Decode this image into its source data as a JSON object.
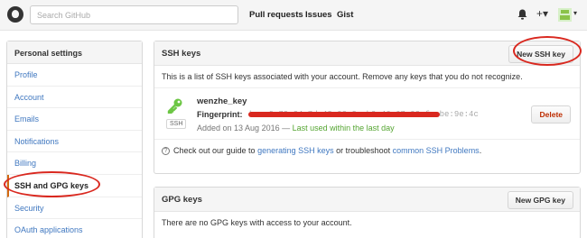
{
  "header": {
    "search_placeholder": "Search GitHub",
    "nav": [
      "Pull requests",
      "Issues",
      "Gist"
    ],
    "plus_glyph": "+▾",
    "bell_glyph": "🔔"
  },
  "sidebar": {
    "title": "Personal settings",
    "items": [
      {
        "label": "Profile"
      },
      {
        "label": "Account"
      },
      {
        "label": "Emails"
      },
      {
        "label": "Notifications"
      },
      {
        "label": "Billing"
      },
      {
        "label": "SSH and GPG keys"
      },
      {
        "label": "Security"
      },
      {
        "label": "OAuth applications"
      }
    ]
  },
  "ssh": {
    "title": "SSH keys",
    "new_button": "New SSH key",
    "description": "This is a list of SSH keys associated with your account. Remove any keys that you do not recognize.",
    "key": {
      "name": "wenzhe_key",
      "fingerprint_label": "Fingerprint:",
      "fingerprint_value": "be:e0:79:24:7d:43:08:2e:b9:46:67:92:fa:be:9e:4c",
      "tag": "SSH",
      "added_prefix": "Added on 13 Aug 2016 — ",
      "last_used": "Last used within the last day",
      "delete_label": "Delete"
    },
    "guide": {
      "prefix": "Check out our guide to ",
      "link1": "generating SSH keys",
      "middle": " or troubleshoot ",
      "link2": "common SSH Problems",
      "suffix": "."
    }
  },
  "gpg": {
    "title": "GPG keys",
    "new_button": "New GPG key",
    "empty": "There are no GPG keys with access to your account."
  },
  "colors": {
    "accent_link": "#4078c0",
    "selected_border": "#d26911",
    "annotation_red": "#d9281f",
    "success_green": "#55a532",
    "danger": "#bd2c00"
  }
}
